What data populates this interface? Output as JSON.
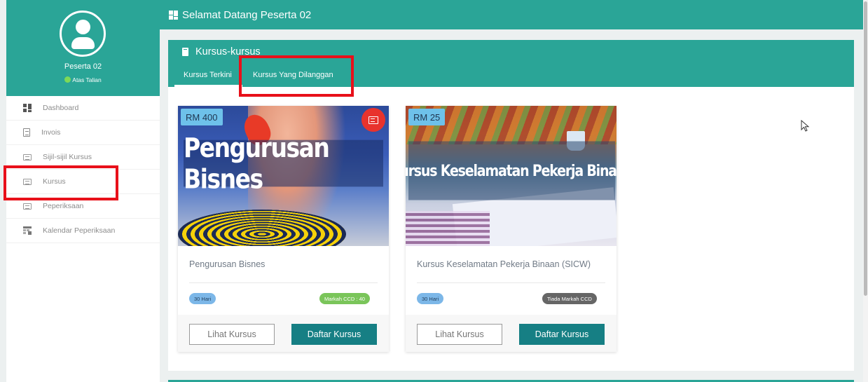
{
  "profile": {
    "name": "Peserta 02",
    "status": "Atas Talian",
    "status_color": "#7ed957"
  },
  "sidebar": {
    "items": [
      {
        "label": "Dashboard",
        "icon": "dashboard-icon"
      },
      {
        "label": "Invois",
        "icon": "invoice-icon"
      },
      {
        "label": "Sijil-sijil Kursus",
        "icon": "certificate-icon"
      },
      {
        "label": "Kursus",
        "icon": "course-icon"
      },
      {
        "label": "Peperiksaan",
        "icon": "exam-icon"
      },
      {
        "label": "Kalendar Peperiksaan",
        "icon": "calendar-icon"
      }
    ]
  },
  "header": {
    "title": "Selamat Datang Peserta 02"
  },
  "panel": {
    "title": "Kursus-kursus",
    "tabs": [
      "Kursus Terkini",
      "Kursus Yang Dilanggan"
    ]
  },
  "courses": [
    {
      "price": "RM 400",
      "banner": "Pengurusan Bisnes",
      "name": "Pengurusan Bisnes",
      "duration": "30 Hari",
      "ccd": "Markah CCD : 40",
      "view_label": "Lihat Kursus",
      "register_label": "Daftar Kursus"
    },
    {
      "price": "RM 25",
      "banner": "Kursus Keselamatan Pekerja Binaan",
      "name": "Kursus Keselamatan Pekerja Binaan (SICW)",
      "duration": "30 Hari",
      "ccd": "Tiada Markah CCD",
      "view_label": "Lihat Kursus",
      "register_label": "Daftar Kursus"
    }
  ],
  "colors": {
    "primary": "#2aa597",
    "button": "#167f84",
    "highlight": "#e8101a"
  }
}
